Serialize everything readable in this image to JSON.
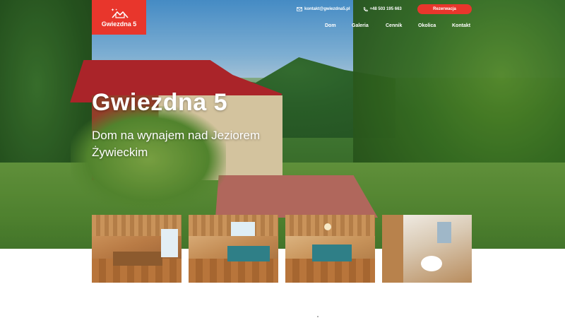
{
  "header": {
    "logo_text": "Gwiezdna 5",
    "email": "kontakt@gwiezdna5.pl",
    "phone": "+48 503 195 663",
    "reserve_label": "Rezerwacja"
  },
  "nav": {
    "items": [
      "Dom",
      "Galeria",
      "Cennik",
      "Okolica",
      "Kontakt"
    ]
  },
  "hero": {
    "title": "Gwiezdna 5",
    "subtitle": "Dom na wynajem nad Jeziorem Żywieckim"
  },
  "gallery": {
    "items": [
      {
        "name": "dining-room"
      },
      {
        "name": "living-room"
      },
      {
        "name": "bedroom"
      },
      {
        "name": "bathroom"
      }
    ]
  },
  "colors": {
    "accent": "#e8362c",
    "white": "#ffffff"
  },
  "icons": {
    "email": "envelope-icon",
    "phone": "phone-icon",
    "logo": "house-stars-icon"
  }
}
